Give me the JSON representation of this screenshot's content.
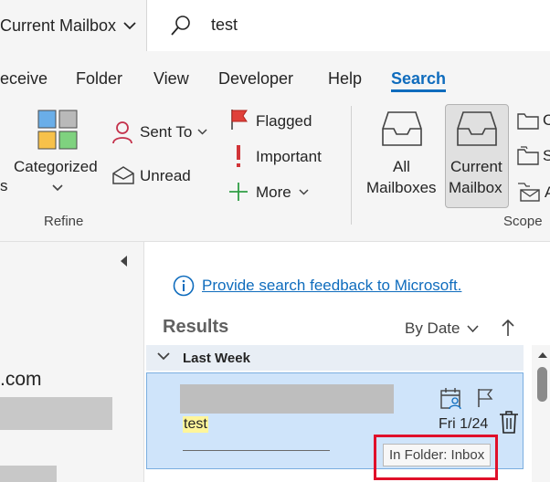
{
  "search": {
    "scope_label": "Current Mailbox",
    "query": "test"
  },
  "tabs": {
    "receive": "eceive",
    "folder": "Folder",
    "view": "View",
    "developer": "Developer",
    "help": "Help",
    "search": "Search",
    "active": "Search"
  },
  "ribbon": {
    "categorized": "Categorized",
    "sent_to": "Sent To",
    "unread": "Unread",
    "flagged": "Flagged",
    "important": "Important",
    "more": "More",
    "left_cut_letter": "s",
    "refine_group": "Refine",
    "all_mailboxes_line1": "All",
    "all_mailboxes_line2": "Mailboxes",
    "current_mailbox_line1": "Current",
    "current_mailbox_line2": "Mailbox",
    "scope_cut_1": "C",
    "scope_cut_2": "S",
    "scope_cut_3": "A",
    "scope_group": "Scope"
  },
  "left_pane": {
    "account_fragment": ".com"
  },
  "results": {
    "feedback_link": "Provide search feedback to Microsoft.",
    "title": "Results",
    "sort_label": "By Date",
    "group_header": "Last Week",
    "message": {
      "subject": "test",
      "date": "Fri 1/24",
      "tooltip": "In Folder: Inbox"
    }
  },
  "colors": {
    "accent": "#0f6cbd",
    "selected_item": "#cfe4fa",
    "highlight": "#fff59a",
    "annotation_red": "#e0102a"
  }
}
